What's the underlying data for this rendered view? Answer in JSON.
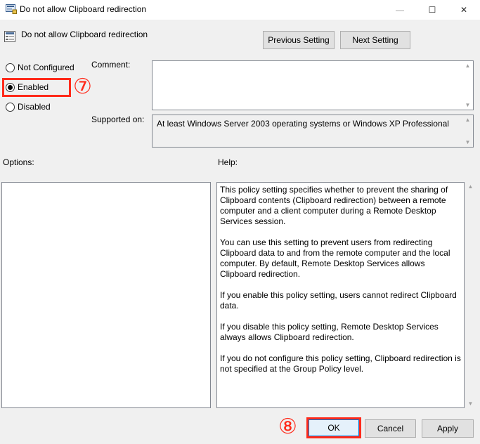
{
  "window": {
    "title": "Do not allow Clipboard redirection",
    "minimize_glyph": "—",
    "maximize_glyph": "☐",
    "close_glyph": "✕"
  },
  "header": {
    "policy_name": "Do not allow Clipboard redirection",
    "previous_label": "Previous Setting",
    "next_label": "Next Setting"
  },
  "state": {
    "options": [
      "Not Configured",
      "Enabled",
      "Disabled"
    ],
    "selected": "Enabled"
  },
  "comment": {
    "label": "Comment:",
    "value": ""
  },
  "supported": {
    "label": "Supported on:",
    "value": "At least Windows Server 2003 operating systems or Windows XP Professional"
  },
  "panes": {
    "options_label": "Options:",
    "help_label": "Help:"
  },
  "help": {
    "paragraphs": [
      "This policy setting specifies whether to prevent the sharing of Clipboard contents (Clipboard redirection) between a remote computer and a client computer during a Remote Desktop Services session.",
      "You can use this setting to prevent users from redirecting Clipboard data to and from the remote computer and the local computer. By default, Remote Desktop Services allows Clipboard redirection.",
      "If you enable this policy setting, users cannot redirect Clipboard data.",
      "If you disable this policy setting, Remote Desktop Services always allows Clipboard redirection.",
      "If you do not configure this policy setting, Clipboard redirection is not specified at the Group Policy level."
    ]
  },
  "footer": {
    "ok_label": "OK",
    "cancel_label": "Cancel",
    "apply_label": "Apply"
  },
  "annotations": {
    "step7": "⑦",
    "step8": "⑧",
    "highlight_color": "#ff2a1a"
  },
  "icons": {
    "title": "policy-window-icon",
    "header": "policy-setting-icon"
  }
}
